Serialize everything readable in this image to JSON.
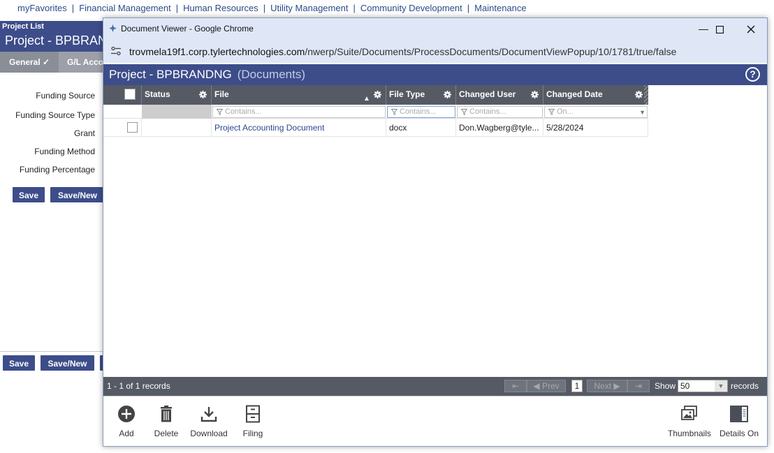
{
  "topnav": {
    "items": [
      "myFavorites",
      "Financial Management",
      "Human Resources",
      "Utility Management",
      "Community Development",
      "Maintenance"
    ],
    "separator": "|"
  },
  "background": {
    "breadcrumb": "Project List",
    "title": "Project - BPBRAN",
    "tabs": [
      "General ✓",
      "G/L Acco"
    ],
    "fields": [
      "Funding Source",
      "Funding Source Type",
      "Grant",
      "Funding Method",
      "Funding Percentage"
    ],
    "buttons_top": [
      "Save",
      "Save/New"
    ],
    "buttons_bottom": [
      "Save",
      "Save/New"
    ]
  },
  "window": {
    "title": "Document Viewer - Google Chrome",
    "url_host": "trovmela19f1.corp.tylertechnologies.com",
    "url_path": "/nwerp/Suite/Documents/ProcessDocuments/DocumentViewPopup/10/1781/true/false",
    "controls": [
      "minimize",
      "maximize",
      "close"
    ]
  },
  "page": {
    "title": "Project - BPBRANDNG",
    "subtitle": "(Documents)"
  },
  "grid": {
    "columns": [
      "Status",
      "File",
      "File Type",
      "Changed User",
      "Changed Date"
    ],
    "filters": {
      "file": "Contains...",
      "file_type": "Contains...",
      "changed_user": "Contains...",
      "changed_date": "On..."
    },
    "rows": [
      {
        "checked": false,
        "status": "",
        "file": "Project Accounting Document",
        "file_type": "docx",
        "changed_user": "Don.Wagberg@tyle...",
        "changed_date": "5/28/2024"
      }
    ]
  },
  "pager": {
    "count_text": "1 - 1 of 1 records",
    "prev": "Prev",
    "next": "Next",
    "page": "1",
    "show_label": "Show",
    "show_value": "50",
    "records_label": "records"
  },
  "toolbar": {
    "add": "Add",
    "delete": "Delete",
    "download": "Download",
    "filing": "Filing",
    "thumbnails": "Thumbnails",
    "details_on": "Details On"
  },
  "colors": {
    "header_blue": "#3d4d8a",
    "grid_header": "#555a64",
    "link": "#2a4a8a",
    "chrome_bar": "#dfe7f7"
  }
}
